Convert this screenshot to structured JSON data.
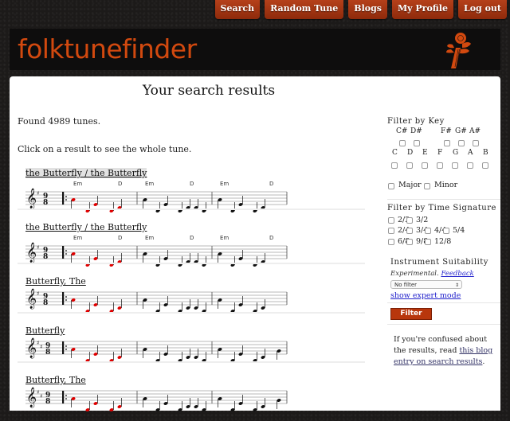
{
  "nav": {
    "items": [
      "Search",
      "Random Tune",
      "Blogs",
      "My Profile",
      "Log out"
    ]
  },
  "header": {
    "logo": "folktunefinder",
    "logo_icon": "fiddle-scroll-icon",
    "accent_color": "#d2490f"
  },
  "main": {
    "title": "Your search results",
    "found_text": "Found 4989 tunes.",
    "instruction": "Click on a result to see the whole tune.",
    "results": [
      {
        "title": "the Butterfly / the Butterfly",
        "key_sharps": 1,
        "time_sig": [
          "9",
          "8"
        ],
        "chords": [
          "Em",
          "D",
          "Em",
          "D",
          "Em",
          "D"
        ],
        "highlighted": true
      },
      {
        "title": "the Butterfly / the Butterfly",
        "key_sharps": 1,
        "time_sig": [
          "9",
          "8"
        ],
        "chords": [
          "Em",
          "D",
          "Em",
          "D",
          "Em",
          "D"
        ],
        "highlighted": false
      },
      {
        "title": "Butterfly, The",
        "key_sharps": 1,
        "time_sig": [
          "9",
          "8"
        ],
        "chords": [],
        "highlighted": false
      },
      {
        "title": "Butterfly",
        "key_sharps": 2,
        "time_sig": [
          "9",
          "8"
        ],
        "chords": [],
        "highlighted": false
      },
      {
        "title": "Butterfly, The",
        "key_sharps": 2,
        "time_sig": [
          "9",
          "8"
        ],
        "chords": [],
        "highlighted": false
      }
    ],
    "match_color": "#e00000"
  },
  "sidebar": {
    "key_heading": "Filter by Key",
    "sharp_keys": [
      "C#",
      "D#",
      "F#",
      "G#",
      "A#"
    ],
    "natural_keys": [
      "C",
      "D",
      "E",
      "F",
      "G",
      "A",
      "B"
    ],
    "modes": [
      "Major",
      "Minor"
    ],
    "time_heading": "Filter by Time Signature",
    "time_rows": [
      [
        "2/2",
        "3/2"
      ],
      [
        "2/4",
        "3/4",
        "4/4",
        "5/4"
      ],
      [
        "6/8",
        "9/8",
        "12/8"
      ]
    ],
    "instrument_heading": "Instrument Suitability",
    "experimental": "Experimental.",
    "feedback": "Feedback",
    "instrument_select": "No filter",
    "expert_mode": "show expert mode",
    "filter_button": "Filter",
    "confused_prefix": "If you're confused about the results, read ",
    "confused_link": "this blog entry on search results",
    "confused_suffix": "."
  }
}
